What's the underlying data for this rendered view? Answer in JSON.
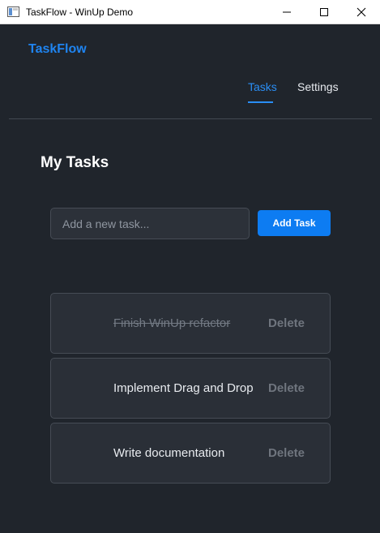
{
  "window": {
    "title": "TaskFlow - WinUp Demo",
    "controls": [
      "minimize",
      "maximize",
      "close"
    ]
  },
  "header": {
    "brand": "TaskFlow",
    "tabs": [
      {
        "label": "Tasks",
        "active": true
      },
      {
        "label": "Settings",
        "active": false
      }
    ]
  },
  "main": {
    "title": "My Tasks",
    "new_task": {
      "placeholder": "Add a new task...",
      "value": "",
      "button_label": "Add Task"
    },
    "tasks": [
      {
        "text": "Finish WinUp refactor",
        "completed": true,
        "delete_label": "Delete"
      },
      {
        "text": "Implement Drag and Drop",
        "completed": false,
        "delete_label": "Delete"
      },
      {
        "text": "Write documentation",
        "completed": false,
        "delete_label": "Delete"
      }
    ]
  },
  "colors": {
    "background": "#20252c",
    "accent": "#1f84f0",
    "button": "#0d7cf2",
    "card": "#2a2f37",
    "card_border": "#464c55",
    "muted_text": "#6f757e"
  }
}
